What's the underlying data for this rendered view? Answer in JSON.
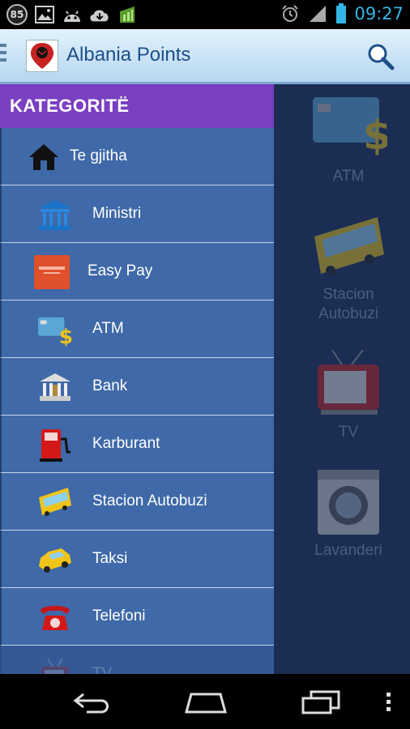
{
  "status_bar": {
    "notification_badge": "85",
    "time": "09:27",
    "icons": [
      "badge-85-icon",
      "image-icon",
      "android-icon",
      "cloud-download-icon",
      "market-icon",
      "alarm-icon",
      "signal-icon",
      "battery-icon"
    ]
  },
  "action_bar": {
    "title": "Albania Points",
    "logo_icon": "albania-map-pin-icon",
    "search_icon": "search-icon"
  },
  "drawer": {
    "header": "KATEGORITË",
    "items": [
      {
        "label": "Te gjitha",
        "icon": "home-icon"
      },
      {
        "label": "Ministri",
        "icon": "ministry-building-icon"
      },
      {
        "label": "Easy Pay",
        "icon": "easypay-logo-icon"
      },
      {
        "label": "ATM",
        "icon": "atm-card-dollar-icon"
      },
      {
        "label": "Bank",
        "icon": "bank-building-icon"
      },
      {
        "label": "Karburant",
        "icon": "fuel-pump-icon"
      },
      {
        "label": "Stacion Autobuzi",
        "icon": "bus-icon"
      },
      {
        "label": "Taksi",
        "icon": "taxi-icon"
      },
      {
        "label": "Telefoni",
        "icon": "telephone-icon"
      },
      {
        "label": "TV",
        "icon": "tv-icon"
      }
    ]
  },
  "content": {
    "tiles": [
      {
        "label": "ATM",
        "icon": "atm-card-dollar-icon"
      },
      {
        "label": "Stacion\nAutobuzi",
        "icon": "bus-icon"
      },
      {
        "label": "TV",
        "icon": "tv-icon"
      },
      {
        "label": "Lavanderi",
        "icon": "washing-machine-icon"
      }
    ]
  },
  "nav_bar": {
    "icons": [
      "back-icon",
      "home-nav-icon",
      "recent-apps-icon",
      "menu-dots-icon"
    ]
  },
  "colors": {
    "drawer_header": "#7b3fc2",
    "drawer_item": "#3f69a8",
    "content_bg": "#1b2d52",
    "status_accent": "#33b5e5",
    "title": "#1d4f8a"
  }
}
